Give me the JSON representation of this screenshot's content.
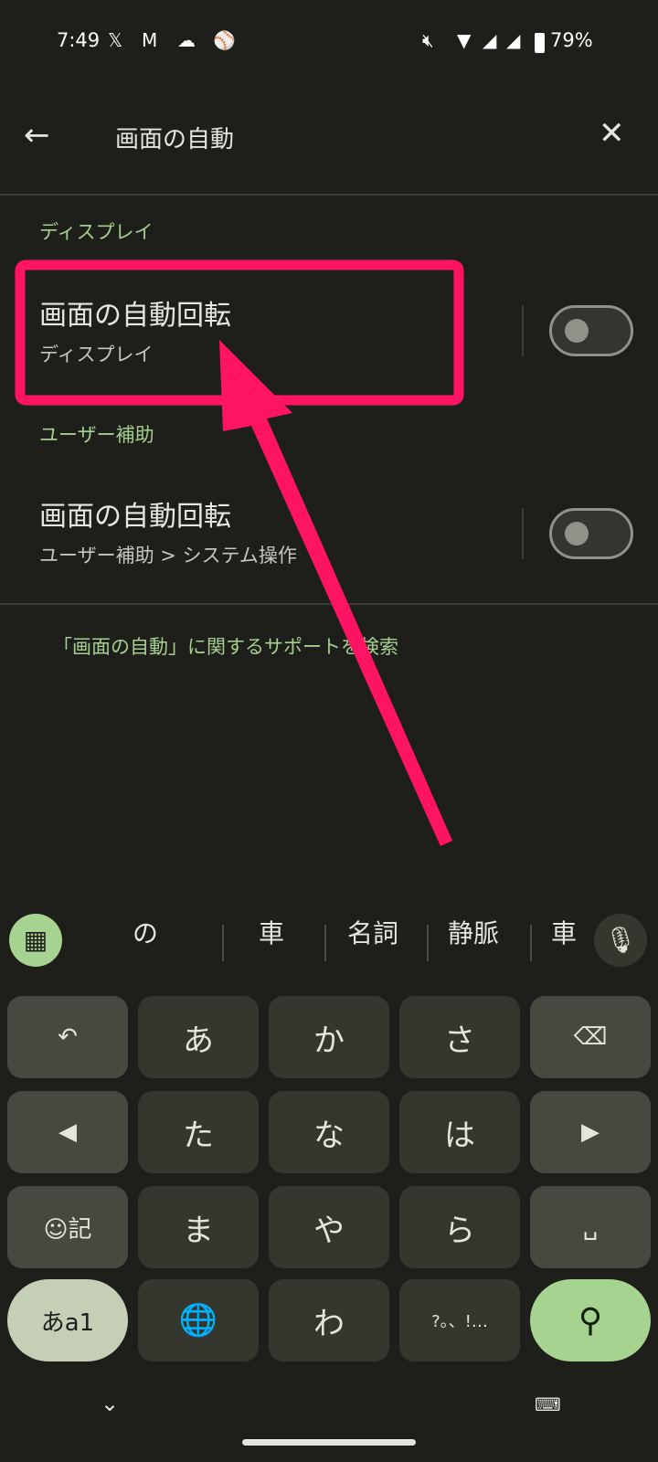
{
  "status": {
    "time": "7:49",
    "battery": "79%",
    "icons": [
      "x-icon",
      "gmail-icon",
      "cloud-icon",
      "baseball-icon",
      "mute-icon",
      "wifi-icon",
      "signal-icon",
      "signal-icon",
      "battery-icon"
    ]
  },
  "search": {
    "query": "画面の自動",
    "back": "back-arrow-icon",
    "clear": "close-icon"
  },
  "results": [
    {
      "category": "ディスプレイ",
      "title": "画面の自動回転",
      "subtitle": "ディスプレイ",
      "enabled": false
    },
    {
      "category": "ユーザー補助",
      "title": "画面の自動回転",
      "subtitle": "ユーザー補助 > システム操作",
      "enabled": false
    }
  ],
  "support_link": "「画面の自動」に関するサポートを検索",
  "annotation": {
    "color": "#ff1463"
  },
  "keyboard": {
    "candidates": [
      "の",
      "車",
      "名詞",
      "静脈",
      "車"
    ],
    "rows": [
      [
        "↶",
        "あ",
        "か",
        "さ",
        "⌫"
      ],
      [
        "◀",
        "た",
        "な",
        "は",
        "▶"
      ],
      [
        "☺記",
        "ま",
        "や",
        "ら",
        "␣"
      ],
      [
        "あa1",
        "🌐",
        "わ",
        "?。、!…",
        "search"
      ]
    ],
    "accent": "#a6d38f"
  }
}
